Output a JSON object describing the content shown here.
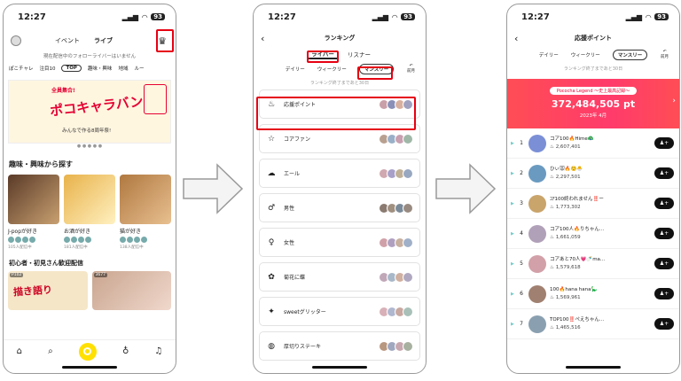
{
  "screen1": {
    "status": {
      "time": "12:27",
      "battery": "93"
    },
    "top_tabs": [
      "イベント",
      "ライブ"
    ],
    "notice": "現在配信中のフォローライバーはいません",
    "categories": [
      "ぽこチャレ",
      "注目10",
      "TOP",
      "趣味・興味",
      "地域",
      "ルー"
    ],
    "banner": {
      "line1": "全員集合!",
      "title": "ポコキャラバン",
      "caption": "みんなで作る8周年祭!"
    },
    "section_hobby": "趣味・興味から探す",
    "cards": [
      {
        "title": "J-popが好き",
        "sub": "105人配信中"
      },
      {
        "title": "お酒が好き",
        "sub": "181人配信中"
      },
      {
        "title": "猫が好き",
        "sub": "138人配信中"
      }
    ],
    "section_beginner": "初心者・初見さん歓迎配信",
    "stream_tags": [
      "P102",
      "3677"
    ],
    "stream_text": "描き語り"
  },
  "screen2": {
    "status": {
      "time": "12:27",
      "battery": "93"
    },
    "title": "ランキング",
    "segments": [
      "ライバー",
      "リスナー"
    ],
    "periods": [
      "デイリー",
      "ウィークリー",
      "マンスリー"
    ],
    "prev_label": "前月",
    "note": "ランキング終了まであと30日",
    "items": [
      {
        "label": "応援ポイント",
        "icon": "flame-icon"
      },
      {
        "label": "コアファン",
        "icon": "star-icon"
      },
      {
        "label": "エール",
        "icon": "cloud-icon"
      },
      {
        "label": "男性",
        "icon": "male-icon"
      },
      {
        "label": "女性",
        "icon": "female-icon"
      },
      {
        "label": "菊花に蝶",
        "icon": "flower-icon"
      },
      {
        "label": "sweetグリッター",
        "icon": "glitter-icon"
      },
      {
        "label": "厚切りステーキ",
        "icon": "steak-icon"
      }
    ]
  },
  "screen3": {
    "status": {
      "time": "12:27",
      "battery": "93"
    },
    "title": "応援ポイント",
    "periods": [
      "デイリー",
      "ウィークリー",
      "マンスリー"
    ],
    "prev_label": "前月",
    "note": "ランキング終了まであと30日",
    "legend": {
      "pill": "Pococha Legend 〜史上最高記録〜",
      "points": "372,484,505 pt",
      "month": "2023年 4月"
    },
    "ranks": [
      {
        "no": "1",
        "name": "コア100🔥Hime🦚",
        "points": "2,607,401",
        "color": "#7b8fd6"
      },
      {
        "no": "2",
        "name": "ひぃ🐭🔥☺️🐣",
        "points": "2,297,501",
        "color": "#6a9ac0"
      },
      {
        "no": "3",
        "name": "ｺｱ100終われません‼️ー",
        "points": "1,773,302",
        "color": "#c9a46b"
      },
      {
        "no": "4",
        "name": "コア100人🔥りちゃん...",
        "points": "1,661,059",
        "color": "#b0a0b8"
      },
      {
        "no": "5",
        "name": "コアあと70人💗🍼ma...",
        "points": "1,579,618",
        "color": "#d2a0a8"
      },
      {
        "no": "6",
        "name": "100🔥hana hana🦕",
        "points": "1,569,961",
        "color": "#a08070"
      },
      {
        "no": "7",
        "name": "TOP100‼️ぺえちゃん...",
        "points": "1,465,516",
        "color": "#8aa0b0"
      }
    ]
  },
  "colors": {
    "accent_red": "#e60012",
    "legend_red": "#ff3b6b",
    "nav_yellow": "#ffe000"
  }
}
